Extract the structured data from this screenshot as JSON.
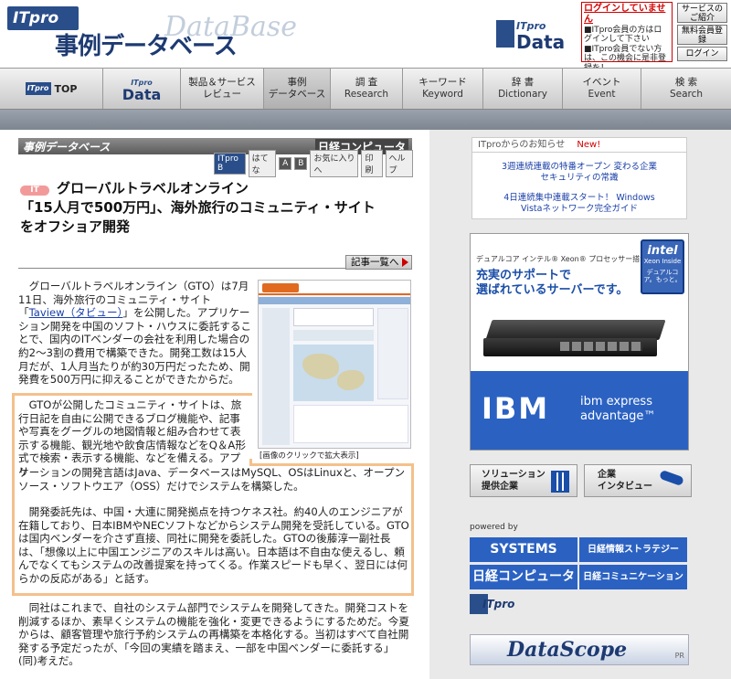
{
  "header": {
    "itpro_logo": "ITpro",
    "title_jp": "事例データベース",
    "title_en": "DataBase",
    "data_logo_it": "ITpro",
    "data_logo_word": "Data",
    "login_notice_title": "ログインしていません",
    "login_notice_body": "■ITpro会員の方はログインして下さい ■ITpro会員でない方は、この機会に是非登録を！",
    "btn_service": "サービスのご紹介",
    "btn_register": "無料会員登録",
    "btn_login": "ログイン"
  },
  "nav": {
    "items": [
      {
        "label": "ITpro TOP",
        "sub": ""
      },
      {
        "label": "ITpro",
        "sub": "Data"
      },
      {
        "label": "製品＆サービス",
        "sub": "レビュー"
      },
      {
        "label": "事例",
        "sub": "データベース"
      },
      {
        "label": "調 査",
        "sub": "Research"
      },
      {
        "label": "キーワード",
        "sub": "Keyword"
      },
      {
        "label": "辞 書",
        "sub": "Dictionary"
      },
      {
        "label": "イベント",
        "sub": "Event"
      },
      {
        "label": "検 索",
        "sub": "Search"
      }
    ]
  },
  "section": {
    "bar_title": "事例データベース",
    "nikkei": "日経コンピュータ",
    "tools": [
      "ITpro B",
      "はてな",
      "A",
      "B",
      "お気に入りへ",
      "印刷",
      "ヘルプ"
    ]
  },
  "article": {
    "category": "IT",
    "title_line1": "グローバルトラベルオンライン",
    "title_line2": "「15人月で500万円」、海外旅行のコミュニティ・サイト",
    "title_line3": "をオフショア開発",
    "list_button": "記事一覧へ",
    "image_caption": "[画像のクリックで拡大表示]",
    "para1": "　グローバルトラベルオンライン（GTO）は7月11日、海外旅行のコミュニティ・サイト「",
    "para1_link": "Taview（タビュー）",
    "para1_rest": "」を公開した。アプリケーション開発を中国のソフト・ハウスに委託することで、国内のITベンダーの会社を利用した場合の約2～3割の費用で構築できた。開発工数は15人月だが、1人月当たりが約30万円だったため、開発費を500万円に抑えることができたからだ。",
    "para2a": "　GTOが公開したコミュニティ・サイトは、旅行日記を自由に公開できるブログ機能や、記事や写真をグーグルの地図情報と組み合わせて表示する機能、観光地や飲食店情報などをQ＆A形式で検索・表示する機能、などを備える。アプリ",
    "para2b": "ケーションの開発言語はJava、データベースはMySQL、OSはLinuxと、オープンソース・ソフトウエア（OSS）だけでシステムを構築した。",
    "para3": "　開発委託先は、中国・大連に開発拠点を持つケネス社。約40人のエンジニアが在籍しており、日本IBMやNECソフトなどからシステム開発を受託している。GTOは国内ベンダーを介さず直接、同社に開発を委託した。GTOの後藤淳一副社長は、「想像以上に中国エンジニアのスキルは高い。日本語は不自由な使えるし、頼んでなくてもシステムの改善提案を持ってくる。作業スピードも早く、翌日には何らかの反応がある」と話す。",
    "para4": "　同社はこれまで、自社のシステム部門でシステムを開発してきた。開発コストを削減するほか、素早くシステムの機能を強化・変更できるようにするためだ。今夏からは、顧客管理や旅行予約システムの再構築を本格化する。当初はすべて自社開発する予定だったが、「今回の実績を踏まえ、一部を中国ベンダーに委託する」(同)考えだ。"
  },
  "sidebar": {
    "notice_title": "ITproからのお知らせ",
    "new_badge": "New!",
    "notice1": "3週連続連載の特番オープン 変わる企業セキュリティの常識",
    "notice2": "4日連続集中連載スタート！ Windows Vistaネットワーク完全ガイド",
    "ad_tagline": "デュアルコア インテル® Xeon® プロセッサー搭載",
    "ad_headline1": "充実のサポートで",
    "ad_headline2": "選ばれているサーバーです。",
    "intel_word": "intel",
    "intel_sub": "Xeon Inside",
    "intel_caption": "デュアルコア。もっと。",
    "ibm_logo": "IBM",
    "ibm_express1": "ibm express",
    "ibm_express2": "advantage™",
    "btn_solution1": "ソリューション",
    "btn_solution2": "提供企業",
    "btn_interview1": "企業",
    "btn_interview2": "インタビュー",
    "powered_by": "powered by",
    "pub1": "SYSTEMS",
    "pub2": "日経情報ストラテジー",
    "pub3": "日経コンピュータ",
    "pub4": "日経コミュニケーション",
    "itpro_small": "ITpro",
    "datascope": "DataScope",
    "pr": "PR"
  },
  "colors": {
    "brand_blue": "#2a4e8a",
    "link_blue": "#1a3fa8",
    "highlight_orange": "#f4c08c",
    "notice_red": "#d00000"
  }
}
